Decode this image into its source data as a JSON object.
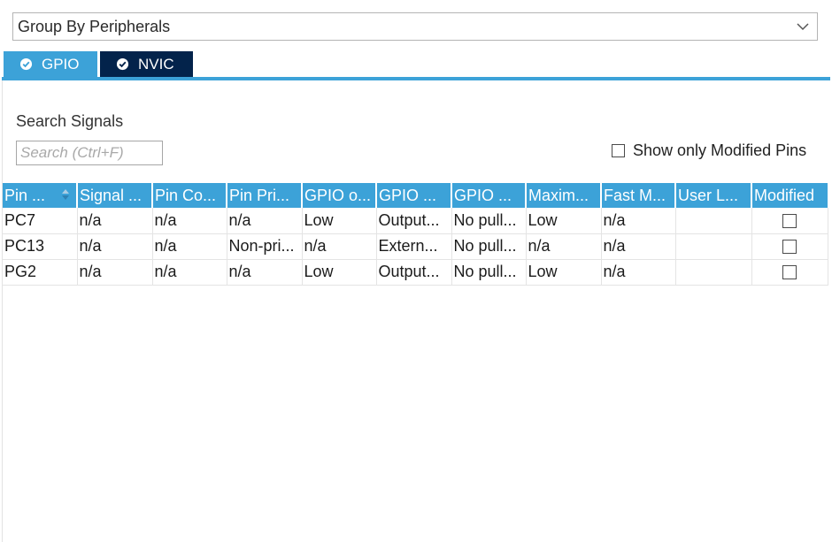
{
  "group_selector": {
    "value": "Group By Peripherals"
  },
  "tabs": [
    {
      "label": "GPIO",
      "selected": true
    },
    {
      "label": "NVIC",
      "selected": false
    }
  ],
  "search": {
    "title": "Search Signals",
    "placeholder": "Search (Ctrl+F)",
    "value": ""
  },
  "modified_filter": {
    "label": "Show only Modified Pins",
    "checked": false
  },
  "table": {
    "columns": [
      "Pin ...",
      "Signal ...",
      "Pin Co...",
      "Pin Pri...",
      "GPIO o...",
      "GPIO ...",
      "GPIO ...",
      "Maxim...",
      "Fast M...",
      "User L...",
      "Modified"
    ],
    "rows": [
      {
        "pin": "PC7",
        "signal": "n/a",
        "context": "n/a",
        "privilege": "n/a",
        "output_level": "Low",
        "mode": "Output...",
        "pull": "No pull...",
        "max_speed": "Low",
        "fast_mode": "n/a",
        "user_label": "",
        "modified": false
      },
      {
        "pin": "PC13",
        "signal": "n/a",
        "context": "n/a",
        "privilege": "Non-pri...",
        "output_level": "n/a",
        "mode": "Extern...",
        "pull": "No pull...",
        "max_speed": "n/a",
        "fast_mode": "n/a",
        "user_label": "",
        "modified": false
      },
      {
        "pin": "PG2",
        "signal": "n/a",
        "context": "n/a",
        "privilege": "n/a",
        "output_level": "Low",
        "mode": "Output...",
        "pull": "No pull...",
        "max_speed": "Low",
        "fast_mode": "n/a",
        "user_label": "",
        "modified": false
      }
    ]
  },
  "colors": {
    "accent": "#3ca2d8",
    "tab_dark": "#03234b"
  }
}
